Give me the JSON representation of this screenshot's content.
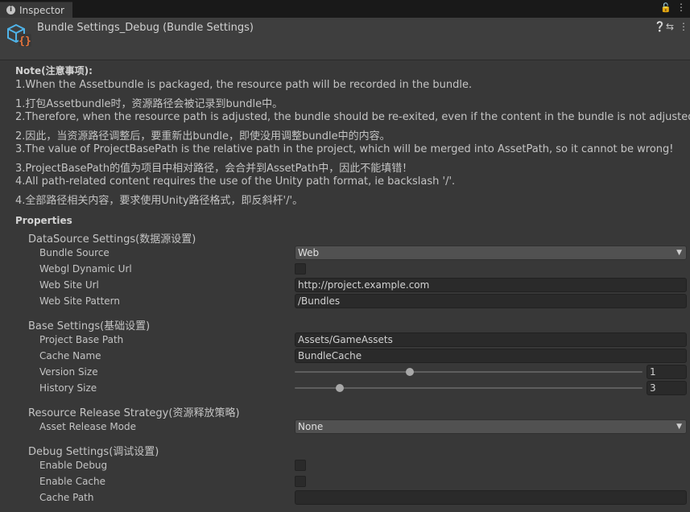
{
  "tab": {
    "label": "Inspector",
    "icon": "info-icon"
  },
  "header": {
    "title": "Bundle Settings_Debug (Bundle Settings)",
    "icon_glyph": "{}"
  },
  "note": {
    "title": "Note(注意事项):",
    "lines": [
      "1.When the Assetbundle is packaged, the resource path will be recorded in the bundle.",
      "1.打包Assetbundle时，资源路径会被记录到bundle中。",
      "2.Therefore, when the resource path is adjusted, the bundle should be re-exited, even if the content in the bundle is not adjusted.",
      "2.因此，当资源路径调整后，要重新出bundle，即使没用调整bundle中的内容。",
      "3.The value of ProjectBasePath is the relative path in the project, which will be merged into AssetPath, so it cannot be wrong!",
      "3.ProjectBasePath的值为项目中相对路径，会合并到AssetPath中，因此不能填错！",
      "4.All path-related content requires the use of the Unity path format, ie backslash '/'.",
      "4.全部路径相关内容，要求使用Unity路径格式，即反斜杆'/'。"
    ]
  },
  "properties": {
    "title": "Properties",
    "datasource": {
      "title": "DataSource Settings(数据源设置)",
      "bundle_source_label": "Bundle Source",
      "bundle_source_value": "Web",
      "webgl_label": "Webgl Dynamic Url",
      "webgl_checked": false,
      "web_site_url_label": "Web Site Url",
      "web_site_url_value": "http://project.example.com",
      "web_site_pattern_label": "Web Site Pattern",
      "web_site_pattern_value": "/Bundles"
    },
    "base": {
      "title": "Base Settings(基础设置)",
      "project_base_path_label": "Project Base Path",
      "project_base_path_value": "Assets/GameAssets",
      "cache_name_label": "Cache Name",
      "cache_name_value": "BundleCache",
      "version_size_label": "Version Size",
      "version_size_value": "1",
      "version_size_fraction": 0.33,
      "history_size_label": "History Size",
      "history_size_value": "3",
      "history_size_fraction": 0.13
    },
    "release": {
      "title": "Resource Release Strategy(资源释放策略)",
      "asset_release_mode_label": "Asset Release Mode",
      "asset_release_mode_value": "None"
    },
    "debug": {
      "title": "Debug Settings(调试设置)",
      "enable_debug_label": "Enable Debug",
      "enable_debug_checked": false,
      "enable_cache_label": "Enable Cache",
      "enable_cache_checked": false,
      "cache_path_label": "Cache Path",
      "cache_path_value": ""
    }
  }
}
